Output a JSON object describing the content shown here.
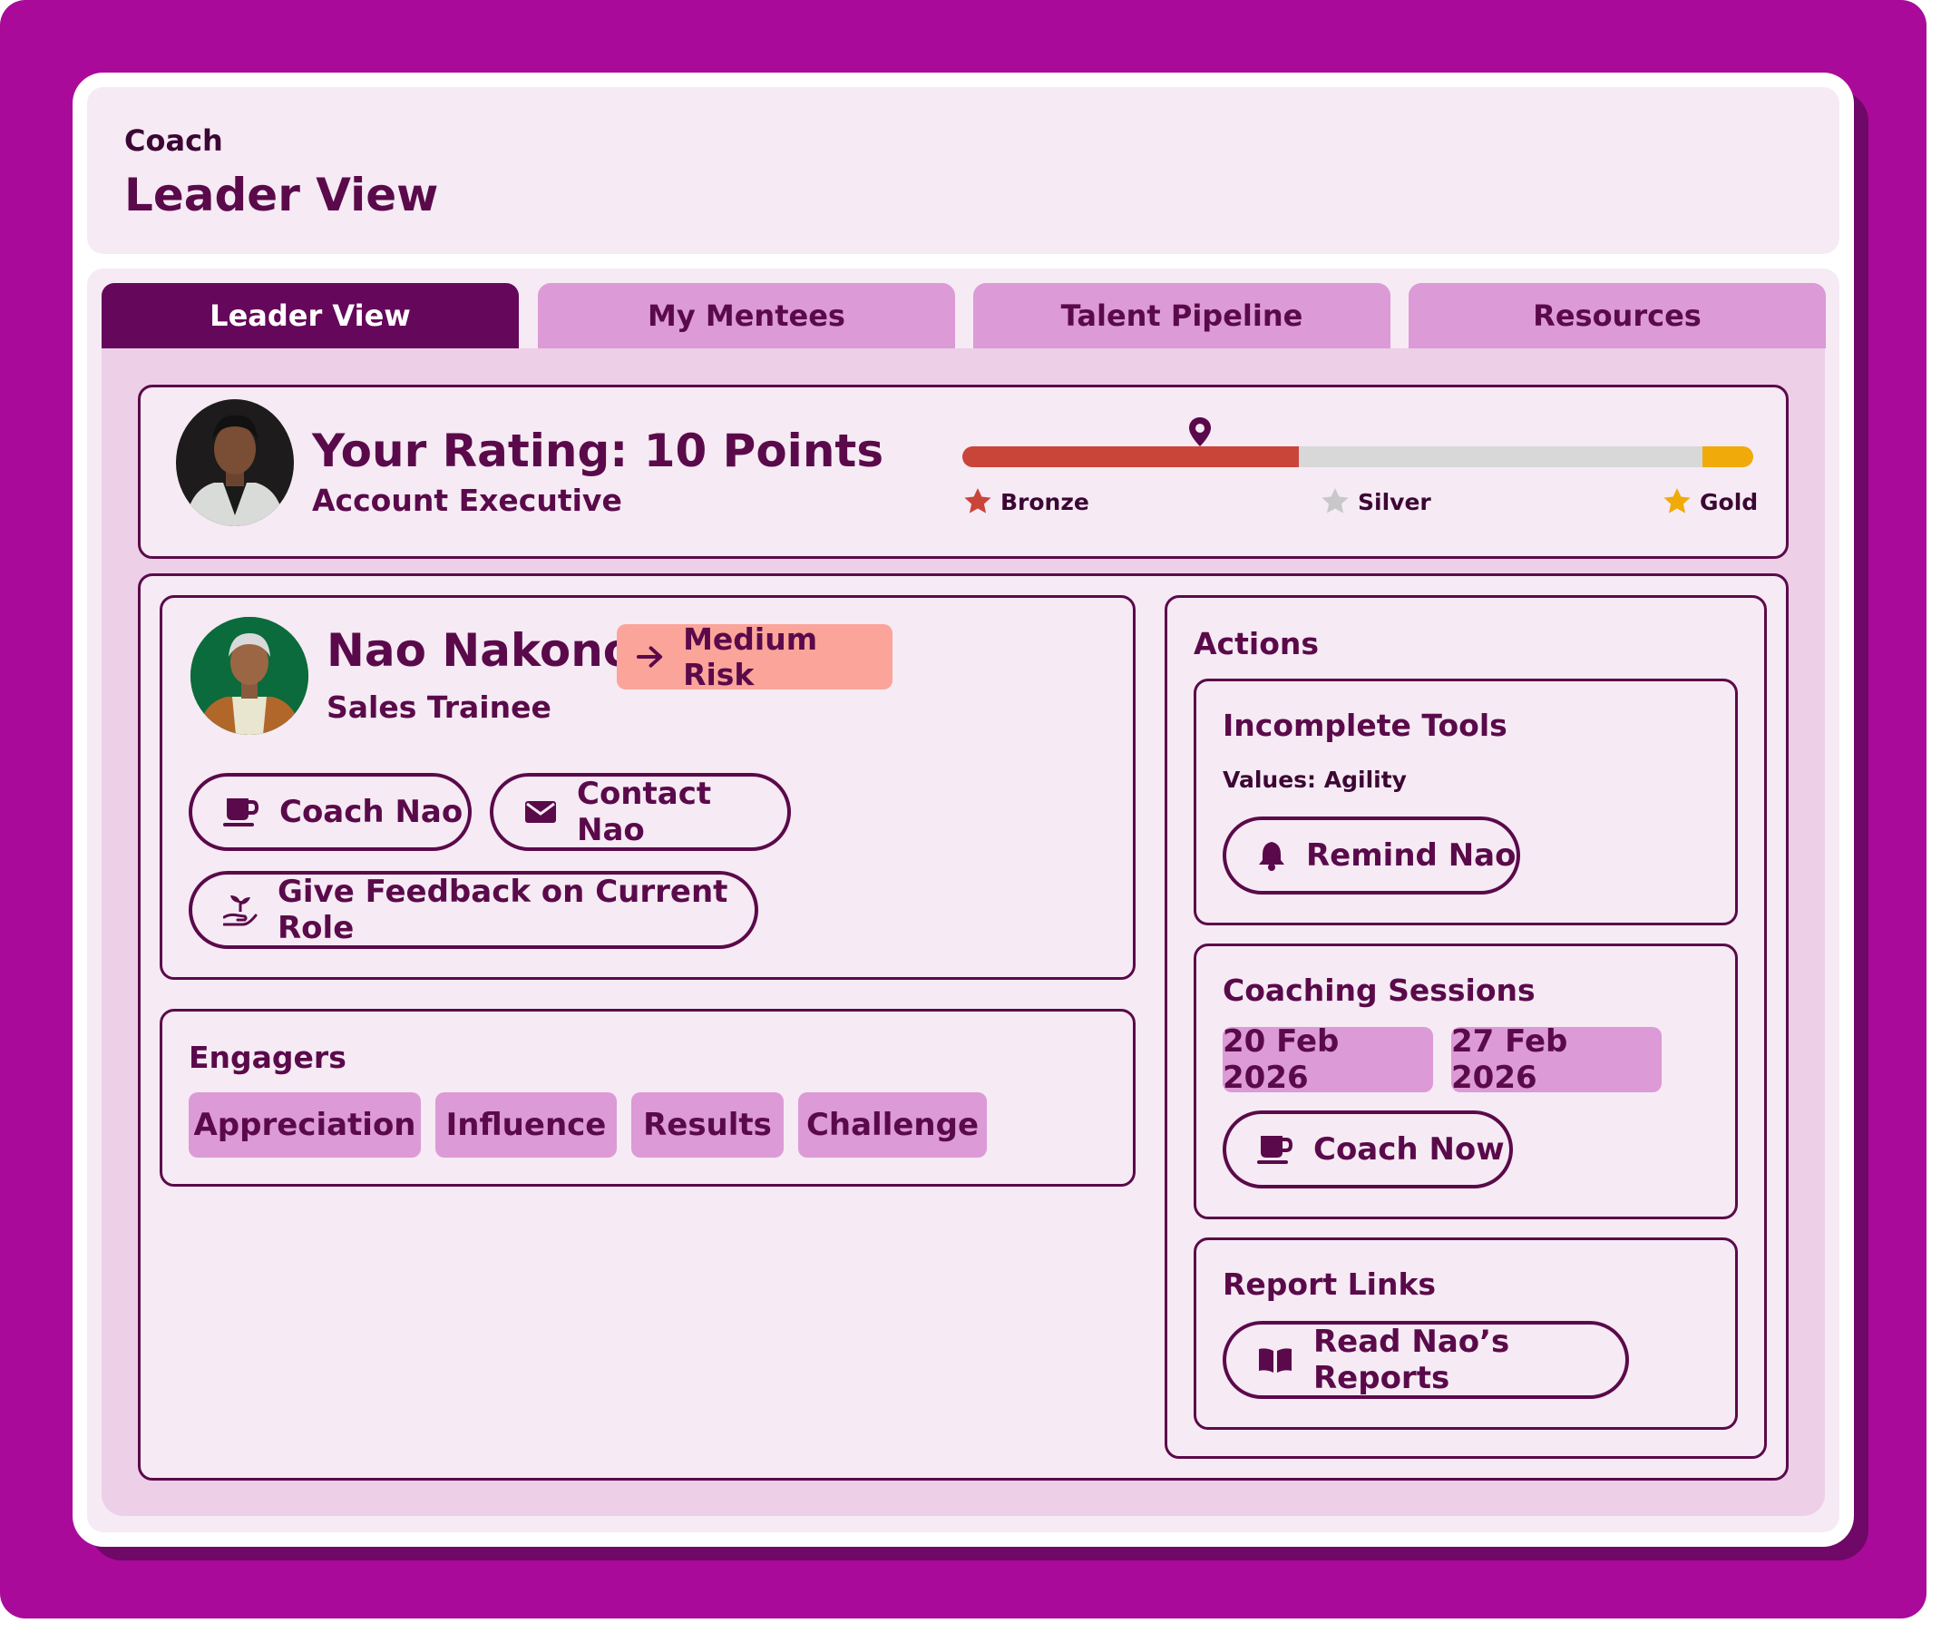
{
  "header": {
    "subtitle": "Coach",
    "title": "Leader View"
  },
  "tabs": [
    {
      "label": "Leader View",
      "active": true
    },
    {
      "label": "My Mentees",
      "active": false
    },
    {
      "label": "Talent Pipeline",
      "active": false
    },
    {
      "label": "Resources",
      "active": false
    }
  ],
  "rating": {
    "title": "Your Rating: 10 Points",
    "role": "Account Executive",
    "progress_fraction": 0.425,
    "marker_fraction": 0.3,
    "tiers": [
      "Bronze",
      "Silver",
      "Gold"
    ]
  },
  "mentee": {
    "name": "Nao Nakono",
    "role": "Sales Trainee",
    "risk_label": "Medium Risk",
    "buttons": {
      "coach": "Coach Nao",
      "contact": "Contact Nao",
      "feedback": "Give Feedback on Current Role"
    }
  },
  "engagers": {
    "heading": "Engagers",
    "items": [
      "Appreciation",
      "Influence",
      "Results",
      "Challenge"
    ]
  },
  "actions": {
    "heading": "Actions",
    "incomplete_tools": {
      "heading": "Incomplete Tools",
      "detail": "Values: Agility",
      "button": "Remind Nao"
    },
    "coaching_sessions": {
      "heading": "Coaching Sessions",
      "dates": [
        "20 Feb 2026",
        "27 Feb 2026"
      ],
      "button": "Coach Now"
    },
    "report_links": {
      "heading": "Report Links",
      "button": "Read Nao’s Reports"
    }
  },
  "colors": {
    "brand": "#aa0a9a",
    "accent_dark": "#65075a",
    "text": "#5a0a4a",
    "chip": "#dc9ad6",
    "risk": "#fba49a",
    "bronze": "#c9453a",
    "silver": "#c8c8c8",
    "gold": "#f0ab0a"
  },
  "icons": [
    "map-pin-icon",
    "star-icon",
    "arrow-right-icon",
    "coffee-cup-icon",
    "envelope-icon",
    "hand-plant-icon",
    "bell-icon",
    "book-icon"
  ]
}
